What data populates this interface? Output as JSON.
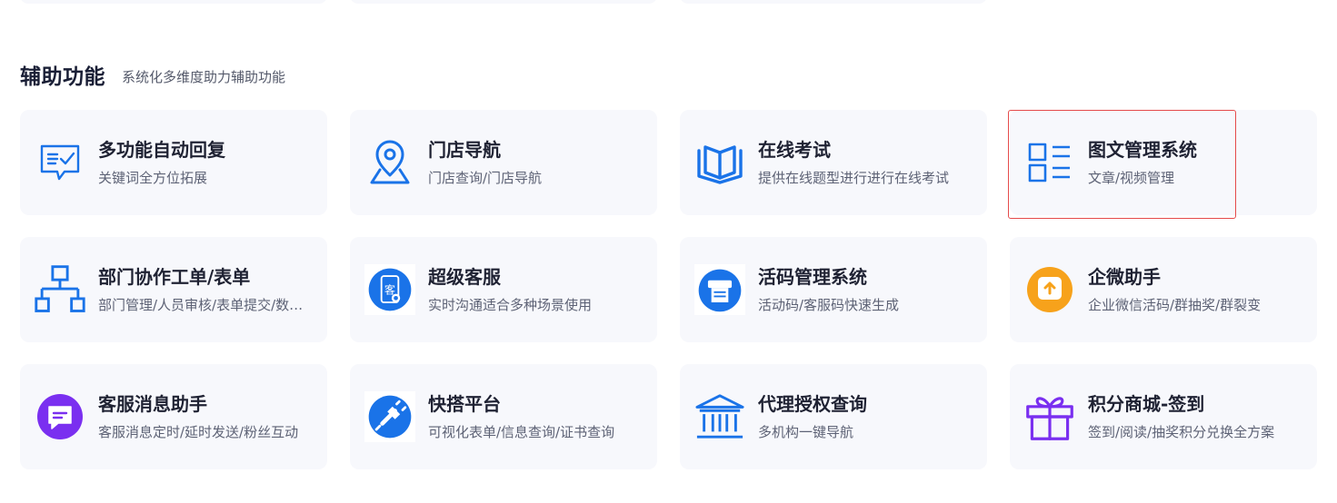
{
  "section": {
    "title": "辅助功能",
    "subtitle": "系统化多维度助力辅助功能"
  },
  "cards": [
    {
      "title": "多功能自动回复",
      "desc": "关键词全方位拓展",
      "icon": "chat-check-icon",
      "color": "#1a73e8"
    },
    {
      "title": "门店导航",
      "desc": "门店查询/门店导航",
      "icon": "map-pin-icon",
      "color": "#1a73e8"
    },
    {
      "title": "在线考试",
      "desc": "提供在线题型进行进行在线考试",
      "icon": "open-book-icon",
      "color": "#1a73e8"
    },
    {
      "title": "图文管理系统",
      "desc": "文章/视频管理",
      "icon": "list-layout-icon",
      "color": "#1a73e8",
      "selected": true
    },
    {
      "title": "部门协作工单/表单",
      "desc": "部门管理/人员审核/表单提交/数据统计",
      "icon": "org-chart-icon",
      "color": "#1a73e8"
    },
    {
      "title": "超级客服",
      "desc": "实时沟通适合多种场景使用",
      "icon": "customer-service-icon",
      "color": "#1a73e8"
    },
    {
      "title": "活码管理系统",
      "desc": "活动码/客服码快速生成",
      "icon": "printer-icon",
      "color": "#1a73e8"
    },
    {
      "title": "企微助手",
      "desc": "企业微信活码/群抽奖/群裂变",
      "icon": "upload-square-icon",
      "color": "#f7a21b"
    },
    {
      "title": "客服消息助手",
      "desc": "客服消息定时/延时发送/粉丝互动",
      "icon": "message-bubble-icon",
      "color": "#7a2ff0"
    },
    {
      "title": "快搭平台",
      "desc": "可视化表单/信息查询/证书查询",
      "icon": "plug-icon",
      "color": "#1a73e8"
    },
    {
      "title": "代理授权查询",
      "desc": "多机构一键导航",
      "icon": "institution-icon",
      "color": "#1a73e8"
    },
    {
      "title": "积分商城-签到",
      "desc": "签到/阅读/抽奖积分兑换全方案",
      "icon": "gift-icon",
      "color": "#7a2ff0"
    }
  ]
}
